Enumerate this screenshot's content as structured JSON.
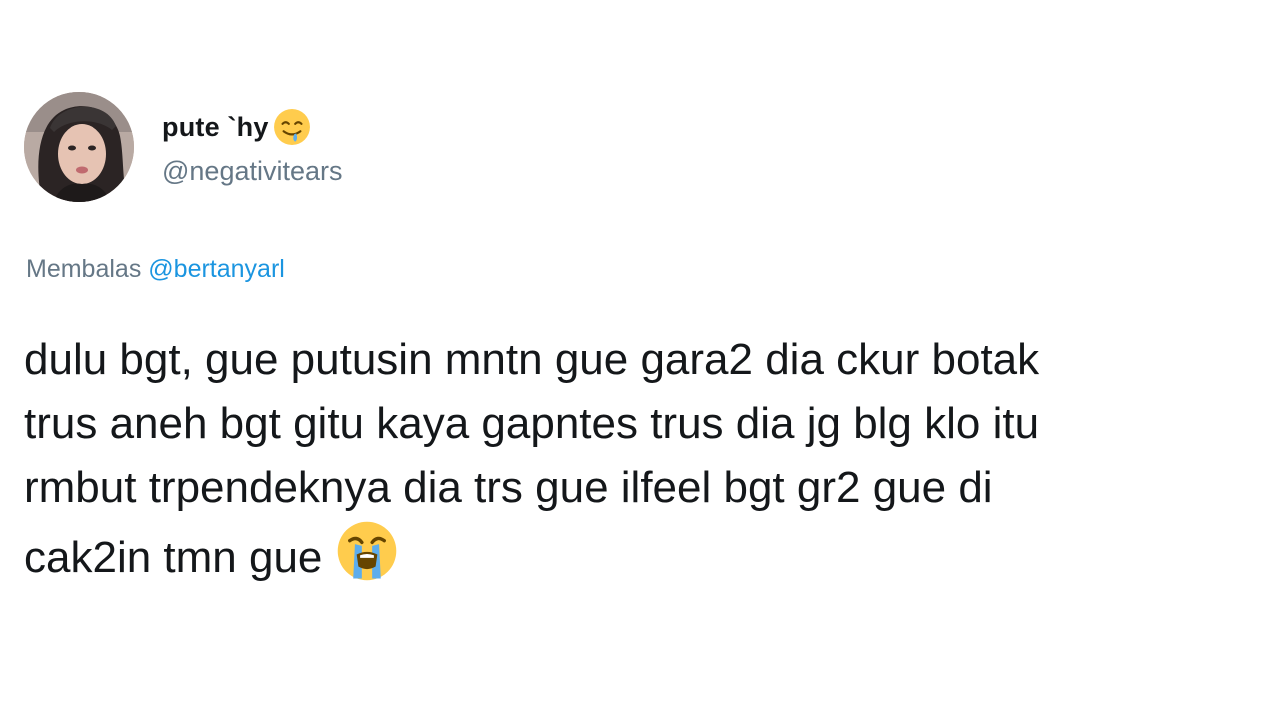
{
  "author": {
    "display_name": "pute `hy",
    "name_emoji": "drooling-face-emoji",
    "handle": "@negativitears"
  },
  "reply": {
    "prefix": "Membalas",
    "mention": "@bertanyarl"
  },
  "tweet": {
    "lines": [
      "dulu bgt, gue putusin mntn gue gara2 dia ckur botak",
      "trus aneh bgt gitu kaya gapntes trus dia jg blg klo itu",
      "rmbut trpendeknya dia trs gue ilfeel bgt gr2 gue di",
      "cak2in tmn gue"
    ],
    "trailing_emoji": "loudly-crying-face-emoji"
  },
  "colors": {
    "text": "#14171a",
    "secondary": "#657786",
    "link": "#1b95e0",
    "emoji_yellow": "#ffcc4d",
    "emoji_tear": "#5dadec"
  }
}
